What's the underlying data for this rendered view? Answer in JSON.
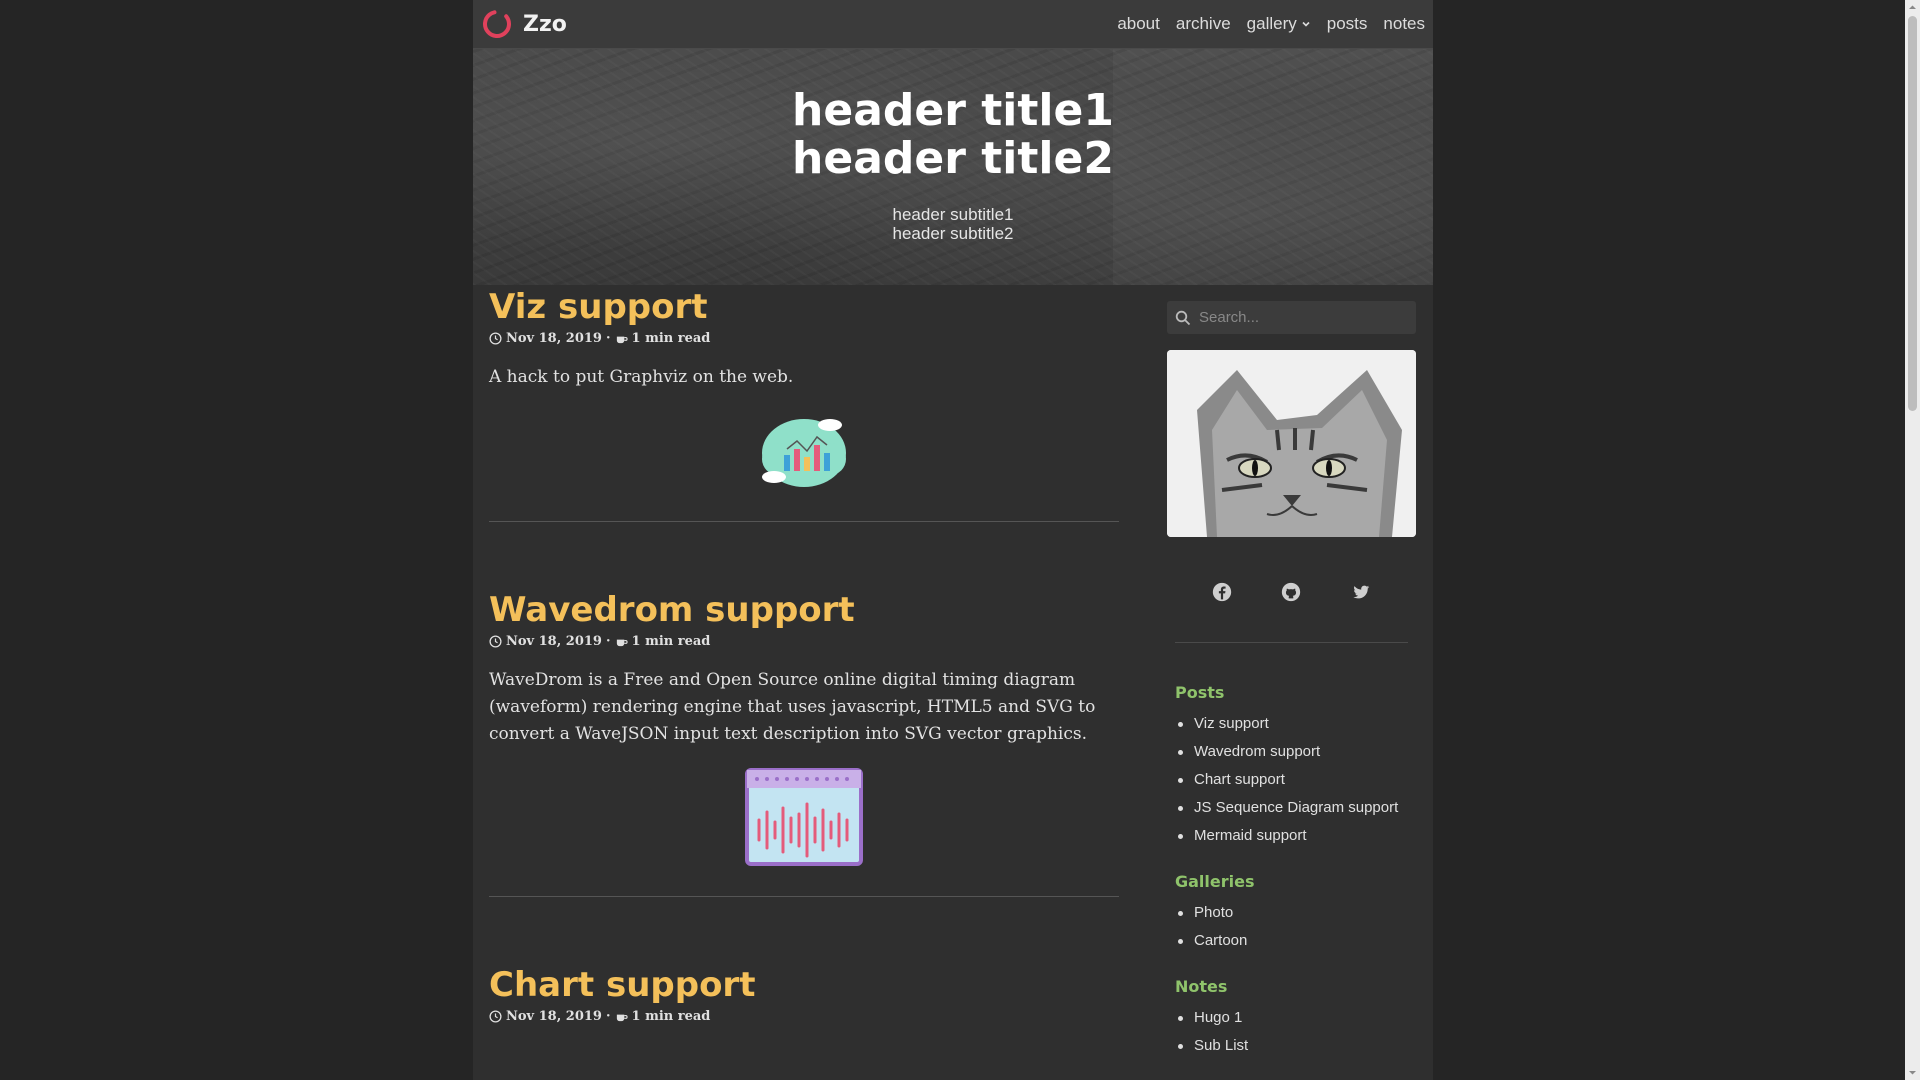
{
  "brand": {
    "name": "Zzo"
  },
  "nav": {
    "items": [
      {
        "label": "about"
      },
      {
        "label": "archive"
      },
      {
        "label": "gallery"
      },
      {
        "label": "posts"
      },
      {
        "label": "notes"
      }
    ]
  },
  "hero": {
    "titles": [
      "header title1",
      "header title2"
    ],
    "subtitles": [
      "header subtitle1",
      "header subtitle2"
    ]
  },
  "posts": [
    {
      "title": "Viz support",
      "date": "Nov 18, 2019",
      "read": "1 min read",
      "summary": "A hack to put Graphviz on the web.",
      "image_icon": "cloud-chart-icon"
    },
    {
      "title": "Wavedrom support",
      "date": "Nov 18, 2019",
      "read": "1 min read",
      "summary": "WaveDrom is a Free and Open Source online digital timing diagram (waveform) rendering engine that uses javascript, HTML5 and SVG to convert a WaveJSON input text description into SVG vector graphics.",
      "image_icon": "waveform-icon"
    },
    {
      "title": "Chart support",
      "date": "Nov 18, 2019",
      "read": "1 min read"
    }
  ],
  "sidebar": {
    "search_placeholder": "Search...",
    "socials": [
      "facebook-icon",
      "github-icon",
      "twitter-icon"
    ],
    "sections": [
      {
        "heading": "Posts",
        "items": [
          "Viz support",
          "Wavedrom support",
          "Chart support",
          "JS Sequence Diagram support",
          "Mermaid support"
        ]
      },
      {
        "heading": "Galleries",
        "items": [
          "Photo",
          "Cartoon"
        ]
      },
      {
        "heading": "Notes",
        "items": [
          "Hugo 1",
          "Sub List"
        ]
      }
    ]
  },
  "colors": {
    "accent_title": "#f4c05a",
    "sidebar_heading": "#8fc36b",
    "background": "#252525",
    "navbar": "#3b3b3b"
  }
}
